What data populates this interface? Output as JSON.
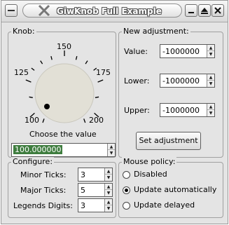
{
  "window": {
    "title": "GiwKnob Full Example"
  },
  "knob_group": {
    "title": "Knob:",
    "scale_labels": [
      "100",
      "125",
      "150",
      "175",
      "200"
    ],
    "caption": "Choose the value",
    "value": "100.000000"
  },
  "adjustment_group": {
    "title": "New adjustment:",
    "value_label": "Value:",
    "value": "-1000000",
    "lower_label": "Lower:",
    "lower": "-1000000",
    "upper_label": "Upper:",
    "upper": "-1000000",
    "set_button": "Set adjustment"
  },
  "configure_group": {
    "title": "Configure:",
    "minor_ticks_label": "Minor Ticks:",
    "minor_ticks": "3",
    "major_ticks_label": "Major Ticks:",
    "major_ticks": "5",
    "legends_digits_label": "Legends Digits:",
    "legends_digits": "3"
  },
  "mouse_policy_group": {
    "title": "Mouse policy:",
    "options": [
      "Disabled",
      "Update automatically",
      "Update delayed"
    ],
    "selected": "Update automatically"
  },
  "colors": {
    "value_highlight": "#3f7d3f",
    "knob_face": "#e2e0d6"
  }
}
